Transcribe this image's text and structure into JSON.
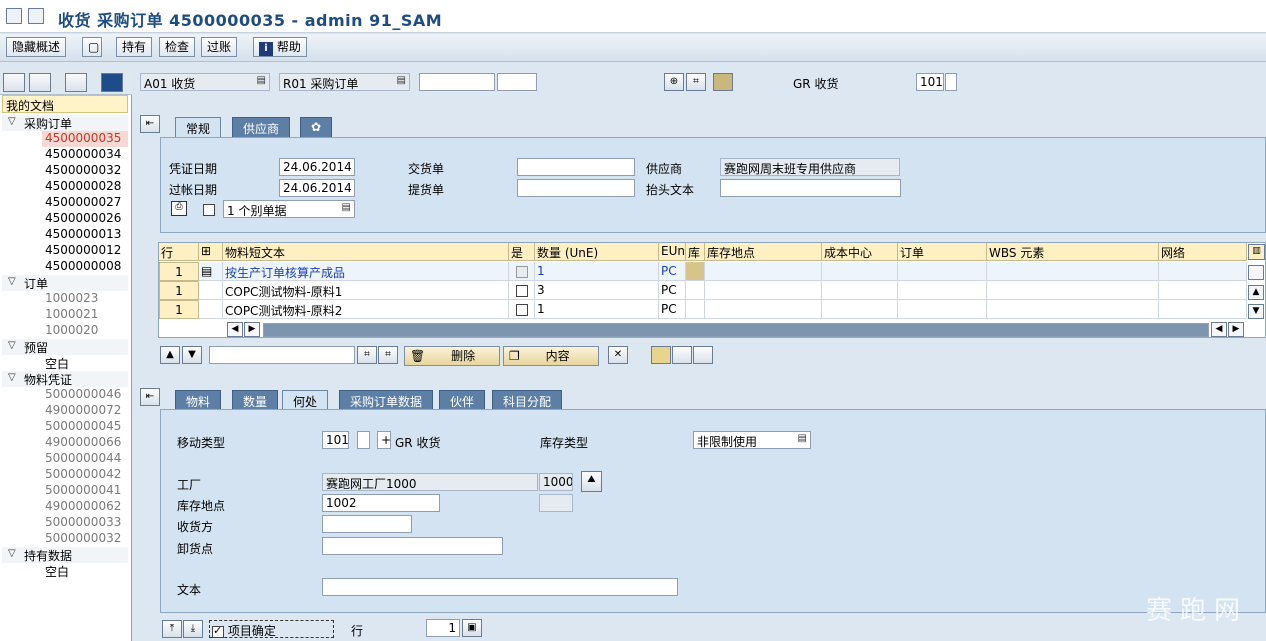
{
  "window": {
    "title": "收货 采购订单 4500000035 - admin 91_SAM"
  },
  "toolbar": {
    "hide_overview": "隐藏概述",
    "hold": "持有",
    "check": "检查",
    "post": "过账",
    "help": "帮助"
  },
  "left": {
    "my_docs": "我的文档",
    "groups": [
      {
        "label": "采购订单",
        "items": [
          "4500000035",
          "4500000034",
          "4500000032",
          "4500000028",
          "4500000027",
          "4500000026",
          "4500000013",
          "4500000012",
          "4500000008"
        ]
      },
      {
        "label": "订单",
        "items": [
          "1000023",
          "1000021",
          "1000020"
        ]
      },
      {
        "label": "预留",
        "items": [
          "空白"
        ]
      },
      {
        "label": "物料凭证",
        "items": [
          "5000000046",
          "4900000072",
          "5000000045",
          "4900000066",
          "5000000044",
          "5000000042",
          "5000000041",
          "4900000062",
          "5000000033",
          "5000000032"
        ]
      },
      {
        "label": "持有数据",
        "items": [
          "空白"
        ]
      }
    ]
  },
  "header": {
    "transaction": "A01 收货",
    "reference": "R01 采购订单",
    "po_number": "",
    "po_item": "",
    "gr_label": "GR 收货",
    "movement": "101",
    "movement_ind": ""
  },
  "top_tabs": [
    "常规",
    "供应商",
    "✿"
  ],
  "general": {
    "doc_date_label": "凭证日期",
    "doc_date": "24.06.2014",
    "post_date_label": "过帐日期",
    "post_date": "24.06.2014",
    "delivery_note_label": "交货单",
    "delivery_note": "",
    "bill_of_lading_label": "提货单",
    "bill_of_lading": "",
    "vendor_label": "供应商",
    "vendor": "赛跑网周末班专用供应商",
    "header_text_label": "抬头文本",
    "header_text": "",
    "slip": "1 个别单据"
  },
  "grid": {
    "headers": [
      "行",
      "",
      "物料短文本",
      "是",
      "数量 (UnE)",
      "EUn",
      "库",
      "库存地点",
      "成本中心",
      "订单",
      "WBS 元素",
      "网络"
    ],
    "rows": [
      {
        "line": "1",
        "text": "按生产订单核算产成品",
        "qty": "1",
        "unit": "PC"
      },
      {
        "line": "1",
        "text": "COPC测试物料-原料1",
        "qty": "3",
        "unit": "PC"
      },
      {
        "line": "1",
        "text": "COPC测试物料-原料2",
        "qty": "1",
        "unit": "PC"
      }
    ]
  },
  "grid_tools": {
    "search": "",
    "delete": "删除",
    "content": "内容"
  },
  "detail_tabs": [
    "物料",
    "数量",
    "何处",
    "采购订单数据",
    "伙伴",
    "科目分配"
  ],
  "where": {
    "movement_type_label": "移动类型",
    "movement_type": "101",
    "movement_type_ind": "",
    "movement_plus": "+",
    "movement_text": "GR 收货",
    "stock_type_label": "库存类型",
    "stock_type": "非限制使用",
    "plant_label": "工厂",
    "plant_name": "赛跑网工厂1000",
    "plant_code": "1000",
    "sloc_label": "库存地点",
    "sloc": "1002",
    "sloc_extra": "",
    "recipient_label": "收货方",
    "recipient": "",
    "unloading_label": "卸货点",
    "unloading": "",
    "text_label": "文本",
    "text": ""
  },
  "bottom": {
    "item_ok": "项目确定",
    "line_label": "行",
    "line_value": "1"
  },
  "watermark": "赛跑网"
}
